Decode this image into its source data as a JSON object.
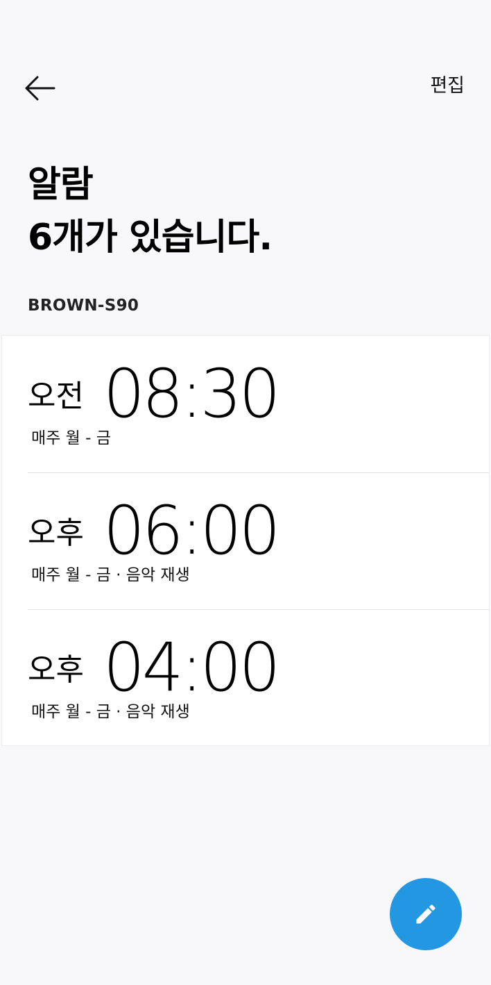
{
  "header": {
    "back_icon": "arrow-left-icon",
    "edit_label": "편집"
  },
  "title": {
    "line1": "알람",
    "line2": "6개가 있습니다."
  },
  "device": {
    "name": "BROWN-S90"
  },
  "alarms": [
    {
      "period": "오전",
      "time": "08:30",
      "description": "매주 월 - 금"
    },
    {
      "period": "오후",
      "time": "06:00",
      "description": "매주 월 - 금 · 음악 재생"
    },
    {
      "period": "오후",
      "time": "04:00",
      "description": "매주 월 - 금 · 음악 재생"
    }
  ],
  "fab": {
    "icon": "pencil-icon",
    "color": "#2497e3"
  }
}
